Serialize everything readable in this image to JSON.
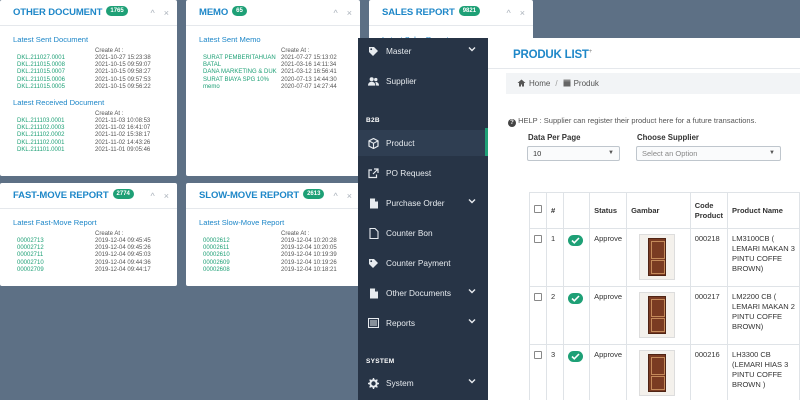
{
  "widgets": {
    "other_document": {
      "title": "OTHER DOCUMENT",
      "badge": "1765",
      "sent_title": "Latest Sent Document",
      "sent_created_at": "Create At :",
      "sent_rows": [
        [
          "DKL.211027.0001",
          "2021-10-27 15:23:38"
        ],
        [
          "DKL.211015.0008",
          "2021-10-15 09:59:07"
        ],
        [
          "DKL.211015.0007",
          "2021-10-15 09:58:27"
        ],
        [
          "DKL.211015.0006",
          "2021-10-15 09:57:53"
        ],
        [
          "DKL.211015.0005",
          "2021-10-15 09:56:22"
        ]
      ],
      "received_title": "Latest Received Document",
      "received_created_at": "Create At :",
      "received_rows": [
        [
          "DKL.211103.0001",
          "2021-11-03 10:08:53"
        ],
        [
          "DKL.211102.0003",
          "2021-11-02 16:41:07"
        ],
        [
          "DKL.211102.0002",
          "2021-11-02 15:38:17"
        ],
        [
          "DKL.211102.0001",
          "2021-11-02 14:43:26"
        ],
        [
          "DKL.211101.0001",
          "2021-11-01 09:05:46"
        ]
      ]
    },
    "memo": {
      "title": "MEMO",
      "badge": "65",
      "sent_title": "Latest Sent Memo",
      "created_at": "Create At :",
      "rows": [
        [
          "SURAT PEMBERITAHUAN BATAL",
          "2021-07-27 15:13:02"
        ],
        [
          "",
          "2021-03-16 14:11:34"
        ],
        [
          "DANA MARKETING & DUK",
          "2021-03-12 16:56:41"
        ],
        [
          "SURAT BIAYA SPG 10%",
          "2020-07-13 14:44:30"
        ],
        [
          "memo",
          "2020-07-07 14:27:44"
        ]
      ]
    },
    "sales_report": {
      "title": "SALES REPORT",
      "badge": "9821",
      "latest": "Latest Sales Report"
    },
    "fast_move": {
      "title": "FAST-MOVE REPORT",
      "badge": "2774",
      "latest_title": "Latest Fast-Move Report",
      "created_at": "Create At :",
      "rows": [
        [
          "00002713",
          "2019-12-04 09:45:45"
        ],
        [
          "00002712",
          "2019-12-04 09:45:26"
        ],
        [
          "00002711",
          "2019-12-04 09:45:03"
        ],
        [
          "00002710",
          "2019-12-04 09:44:36"
        ],
        [
          "00002709",
          "2019-12-04 09:44:17"
        ]
      ]
    },
    "slow_move": {
      "title": "SLOW-MOVE REPORT",
      "badge": "2613",
      "latest_title": "Latest Slow-Move Report",
      "created_at": "Create At :",
      "rows": [
        [
          "00002612",
          "2019-12-04 10:20:28"
        ],
        [
          "00002611",
          "2019-12-04 10:20:05"
        ],
        [
          "00002610",
          "2019-12-04 10:19:39"
        ],
        [
          "00002609",
          "2019-12-04 10:19:26"
        ],
        [
          "00002608",
          "2019-12-04 10:18:21"
        ]
      ]
    }
  },
  "sidebar": {
    "items": [
      {
        "label": "Master",
        "icon": "tag-icon",
        "has_chevron": true
      },
      {
        "label": "Supplier",
        "icon": "users-icon",
        "has_chevron": false
      },
      {
        "section": "B2B"
      },
      {
        "label": "Product",
        "icon": "cube-icon",
        "has_chevron": false,
        "active": true
      },
      {
        "label": "PO Request",
        "icon": "external-link-icon",
        "has_chevron": false
      },
      {
        "label": "Purchase Order",
        "icon": "file-icon",
        "has_chevron": true
      },
      {
        "label": "Counter Bon",
        "icon": "document-icon",
        "has_chevron": false
      },
      {
        "label": "Counter Payment",
        "icon": "tag-icon",
        "has_chevron": false
      },
      {
        "label": "Other Documents",
        "icon": "file-icon",
        "has_chevron": true
      },
      {
        "label": "Reports",
        "icon": "list-icon",
        "has_chevron": true
      },
      {
        "section": "SYSTEM"
      },
      {
        "label": "System",
        "icon": "gear-icon",
        "has_chevron": true
      }
    ]
  },
  "main": {
    "title": "PRODUK LIST",
    "title_sup": "+",
    "breadcrumb": [
      "Home",
      "Produk"
    ],
    "help": "HELP : Supplier can register their product here for a future transactions.",
    "per_page_label": "Data Per Page",
    "per_page_value": "10",
    "supplier_label": "Choose Supplier",
    "supplier_placeholder": "Select an Option",
    "columns": [
      "",
      "#",
      "",
      "Status",
      "Gambar",
      "Code Product",
      "Product Name"
    ],
    "rows": [
      {
        "no": "1",
        "status": "Approve",
        "code": "000218",
        "name": "LM3100CB ( LEMARI MAKAN 3 PINTU COFFE BROWN)"
      },
      {
        "no": "2",
        "status": "Approve",
        "code": "000217",
        "name": "LM2200 CB ( LEMARI MAKAN 2 PINTU COFFE BROWN)"
      },
      {
        "no": "3",
        "status": "Approve",
        "code": "000216",
        "name": "LH3300 CB (LEMARI HIAS 3 PINTU COFFE BROWN )"
      }
    ]
  },
  "colors": {
    "accent": "#1e87c8",
    "success": "#1ea076",
    "sidebar_bg": "#273446",
    "backdrop": "#5d7085"
  }
}
